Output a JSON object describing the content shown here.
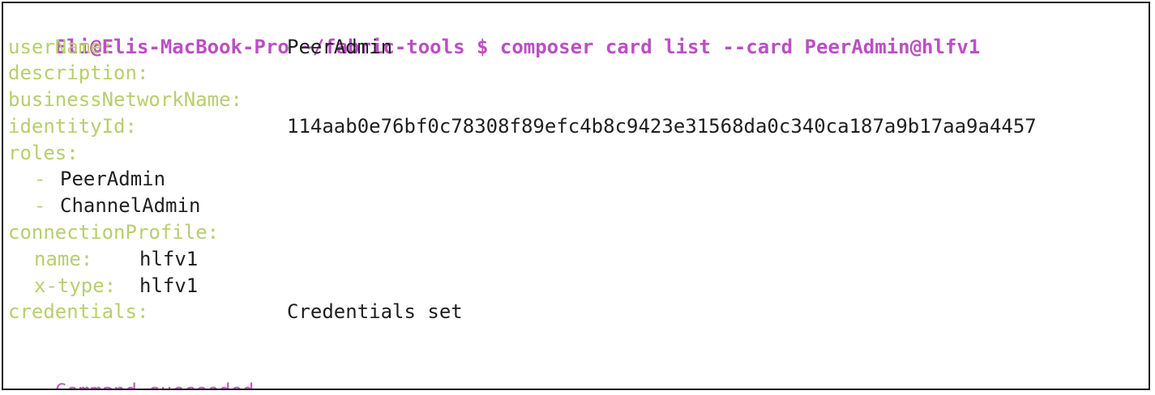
{
  "colors": {
    "prompt": "#bb4fc4",
    "key": "#b7cf6d",
    "value": "#1f1f1f",
    "status": "#c155c9"
  },
  "terminal": {
    "prompt": "Eli@Elis-MacBook-Pro ~/fabric-tools $ composer card list --card PeerAdmin@hlfv1",
    "fields": {
      "userName": {
        "key": "userName:",
        "value": "PeerAdmin"
      },
      "description": {
        "key": "description:"
      },
      "businessNetworkName": {
        "key": "businessNetworkName:"
      },
      "identityId": {
        "key": "identityId:",
        "value": "114aab0e76bf0c78308f89efc4b8c9423e31568da0c340ca187a9b17aa9a4457"
      },
      "roles": {
        "key": "roles:",
        "items": [
          "PeerAdmin",
          "ChannelAdmin"
        ],
        "bullet": "-"
      },
      "connectionProfile": {
        "key": "connectionProfile:",
        "name": {
          "key": "name:",
          "value": "hlfv1"
        },
        "xtype": {
          "key": "x-type:",
          "value": "hlfv1"
        }
      },
      "credentials": {
        "key": "credentials:",
        "value": "Credentials set"
      }
    },
    "status": "Command succeeded"
  }
}
